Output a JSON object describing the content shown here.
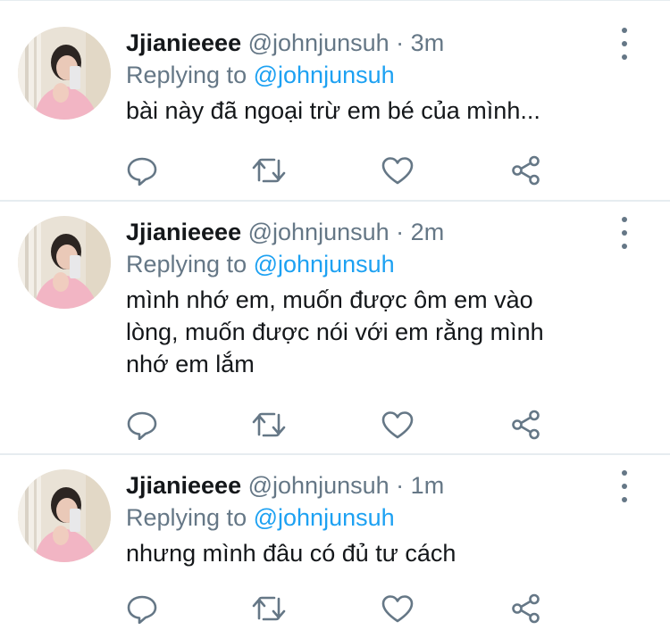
{
  "colors": {
    "text": "#14171a",
    "muted": "#657786",
    "link": "#1da1f2",
    "divider": "#e6ecf0"
  },
  "tweets": [
    {
      "name": "Jjianieeee",
      "handle": "@johnjunsuh",
      "separator": "·",
      "time": "3m",
      "replying_label": "Replying to",
      "replying_to": "@johnjunsuh",
      "text": "bài này đã ngoại trừ em bé của mình...",
      "icons": [
        "reply-icon",
        "retweet-icon",
        "like-icon",
        "share-icon",
        "more-icon"
      ]
    },
    {
      "name": "Jjianieeee",
      "handle": "@johnjunsuh",
      "separator": "·",
      "time": "2m",
      "replying_label": "Replying to",
      "replying_to": "@johnjunsuh",
      "text": "mình nhớ em, muốn được ôm em vào\nlòng, muốn được nói với em rằng mình\nnhớ em lắm",
      "icons": [
        "reply-icon",
        "retweet-icon",
        "like-icon",
        "share-icon",
        "more-icon"
      ]
    },
    {
      "name": "Jjianieeee",
      "handle": "@johnjunsuh",
      "separator": "·",
      "time": "1m",
      "replying_label": "Replying to",
      "replying_to": "@johnjunsuh",
      "text": "nhưng mình đâu có đủ tư cách",
      "icons": [
        "reply-icon",
        "retweet-icon",
        "like-icon",
        "share-icon",
        "more-icon"
      ]
    }
  ]
}
